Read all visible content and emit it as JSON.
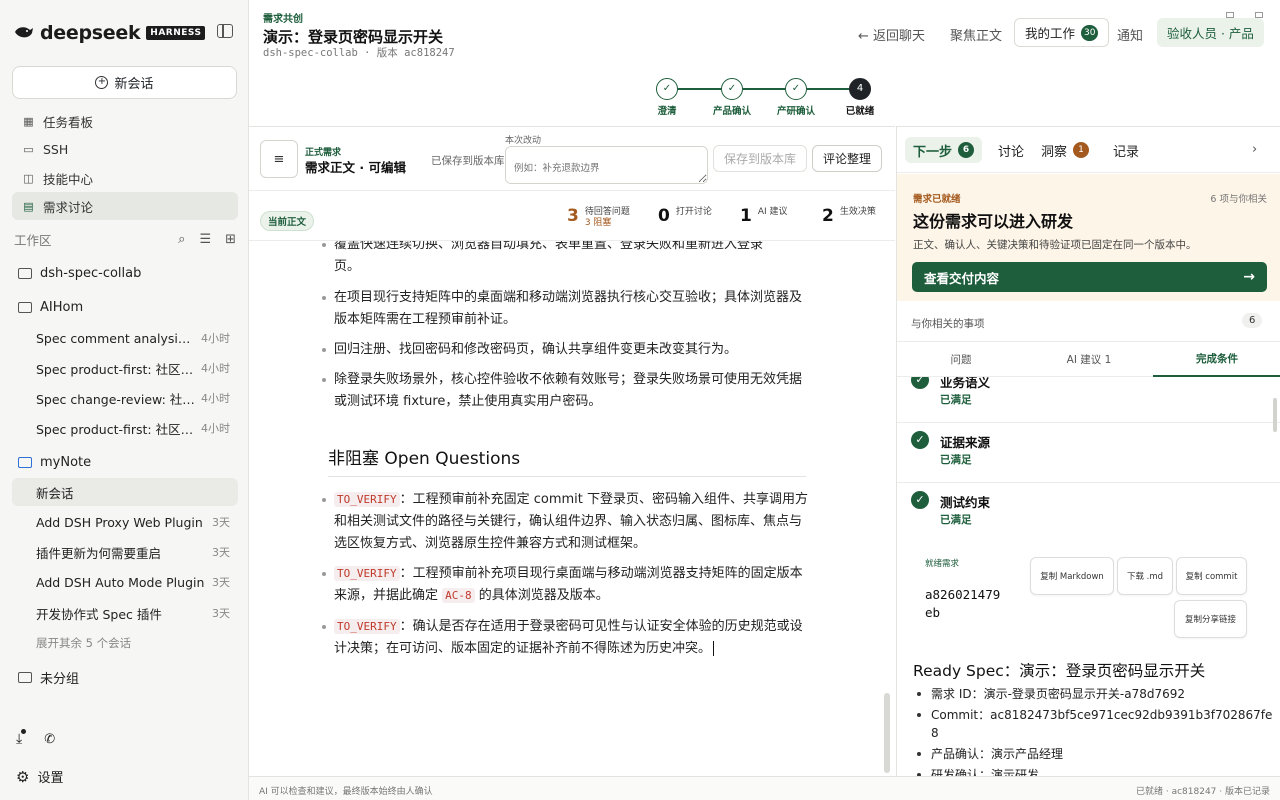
{
  "sidebar": {
    "logo_word": "deepseek",
    "logo_badge": "HARNESS",
    "new_chat": "新会话",
    "nav": [
      {
        "label": "任务看板",
        "icon": "kanban-icon"
      },
      {
        "label": "SSH",
        "icon": "terminal-icon"
      },
      {
        "label": "技能中心",
        "icon": "skills-icon"
      },
      {
        "label": "需求讨论",
        "icon": "discussion-icon"
      }
    ],
    "workspace_label": "工作区",
    "folders": {
      "f1": "dsh-spec-collab",
      "f2": "AIHom",
      "f3": "myNote",
      "f4": "未分组"
    },
    "aihom_items": [
      {
        "title": "Spec comment analysis: ...",
        "time": "4小时"
      },
      {
        "title": "Spec product-first: 社区二期",
        "time": "4小时"
      },
      {
        "title": "Spec change-review: 社区...",
        "time": "4小时"
      },
      {
        "title": "Spec product-first: 社区二期",
        "time": "4小时"
      }
    ],
    "mynote_items": [
      {
        "title": "新会话",
        "time": ""
      },
      {
        "title": "Add DSH Proxy Web Plugin",
        "time": "3天"
      },
      {
        "title": "插件更新为何需要重启",
        "time": "3天"
      },
      {
        "title": "Add DSH Auto Mode Plugin",
        "time": "3天"
      },
      {
        "title": "开发协作式 Spec 插件",
        "time": "3天"
      }
    ],
    "expand_more": "展开其余 5 个会话",
    "settings": "设置"
  },
  "header": {
    "crumb": "需求共创",
    "title": "演示：登录页密码显示开关",
    "subline": "dsh-spec-collab · 版本 ac818247",
    "back": "← 返回聊天",
    "focus": "聚焦正文",
    "my_work": "我的工作",
    "my_work_count": "30",
    "notify": "通知",
    "role": "验收人员 · 产品"
  },
  "stepper": {
    "steps": [
      {
        "label": "澄清",
        "mark": "✓"
      },
      {
        "label": "产品确认",
        "mark": "✓"
      },
      {
        "label": "产研确认",
        "mark": "✓"
      },
      {
        "label": "已就绪",
        "mark": "4"
      }
    ]
  },
  "editor": {
    "tag": "正式需求",
    "title": "需求正文 · 可编辑",
    "saved": "已保存到版本库",
    "change_label": "本次改动",
    "change_placeholder": "例如：补充退款边界",
    "save_btn": "保存到版本库",
    "tidy_btn": "评论整理",
    "current_tag": "当前正文",
    "stats": {
      "q_n": "3",
      "q_label": "待回答问题",
      "q_sub": "3 阻塞",
      "d_n": "0",
      "d_label": "打开讨论",
      "a_n": "1",
      "a_label": "AI 建议",
      "e_n": "2",
      "e_label": "生效决策"
    },
    "partial_top": "覆盖快速连续切换、浏览器自动填充、表单重置、登录失败和重新进入登录",
    "partial_top_end": "页。",
    "bullets": [
      "在项目现行支持矩阵中的桌面端和移动端浏览器执行核心交互验收；具体浏览器及版本矩阵需在工程预审前补证。",
      "回归注册、找回密码和修改密码页，确认共享组件变更未改变其行为。",
      "除登录失败场景外，核心控件验收不依赖有效账号；登录失败场景可使用无效凭据或测试环境 fixture，禁止使用真实用户密码。"
    ],
    "heading": "非阻塞 Open Questions",
    "oq_code": "TO_VERIFY",
    "oq1": "：工程预审前补充固定 commit 下登录页、密码输入组件、共享调用方和相关测试文件的路径与关键行，确认组件边界、输入状态归属、图标库、焦点与选区恢复方式、浏览器原生控件兼容方式和测试框架。",
    "oq2_a": "：工程预审前补充项目现行桌面端与移动端浏览器支持矩阵的固定版本来源，并据此确定 ",
    "oq2_code": "AC-8",
    "oq2_b": " 的具体浏览器及版本。",
    "oq3": "：确认是否存在适用于登录密码可见性与认证安全体验的历史规范或设计决策；在可访问、版本固定的证据补齐前不得陈述为历史冲突。"
  },
  "panel": {
    "tabs": {
      "next": "下一步",
      "next_count": "6",
      "discuss": "讨论",
      "insight": "洞察",
      "insight_count": "1",
      "record": "记录"
    },
    "ready": {
      "tag": "需求已就绪",
      "count": "6 项与你相关",
      "title": "这份需求可以进入研发",
      "desc": "正文、确认人、关键决策和待验证项已固定在同一个版本中。",
      "btn": "查看交付内容",
      "arrow": "→"
    },
    "related": "与你相关的事项",
    "related_count": "6",
    "subtabs": {
      "t1": "问题",
      "t2": "AI 建议 1",
      "t3": "完成条件"
    },
    "conditions": [
      {
        "name": "业务语义",
        "status": "已满足"
      },
      {
        "name": "证据来源",
        "status": "已满足"
      },
      {
        "name": "测试约束",
        "status": "已满足"
      }
    ],
    "export": {
      "tag": "就绪需求",
      "id": "a826021479eb",
      "btn_md": "复制 Markdown",
      "btn_dl": "下载 .md",
      "btn_commit": "复制 commit",
      "btn_share": "复制分享链接"
    },
    "spec_title": "Ready Spec：演示：登录页密码显示开关",
    "spec_items": [
      "需求 ID：演示-登录页密码显示开关-a78d7692",
      "Commit：ac8182473bf5ce971cec92db9391b3f702867fe8",
      "产品确认：演示产品经理",
      "研发确认：演示研发"
    ]
  },
  "status": {
    "left": "AI 可以检查和建议，最终版本始终由人确认",
    "right": "已就绪 · ac818247 · 版本已记录"
  },
  "colors": {
    "accent": "#1e5e3c",
    "warning": "#a45a1f",
    "ready_bg": "#fdf5e8"
  }
}
